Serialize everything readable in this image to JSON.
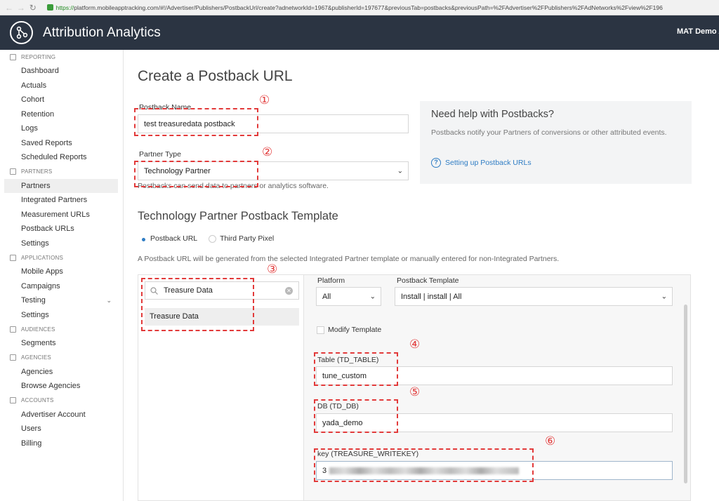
{
  "browser": {
    "url_scheme": "https://",
    "url_rest": "platform.mobileapptracking.com/#!/Advertiser/Publishers/PostbackUrl/create?adnetworkId=1967&publisherId=197677&previousTab=postbacks&previousPath=%2FAdvertiser%2FPublishers%2FAdNetworks%2Fview%2F196"
  },
  "header": {
    "app_title": "Attribution Analytics",
    "account_name": "MAT Demo A"
  },
  "sidebar": {
    "sections": [
      {
        "title": "REPORTING",
        "items": [
          "Dashboard",
          "Actuals",
          "Cohort",
          "Retention",
          "Logs",
          "Saved Reports",
          "Scheduled Reports"
        ]
      },
      {
        "title": "PARTNERS",
        "items": [
          "Partners",
          "Integrated Partners",
          "Measurement URLs",
          "Postback URLs",
          "Settings"
        ]
      },
      {
        "title": "APPLICATIONS",
        "items": [
          "Mobile Apps",
          "Campaigns",
          "Testing",
          "Settings"
        ]
      },
      {
        "title": "AUDIENCES",
        "items": [
          "Segments"
        ]
      },
      {
        "title": "AGENCIES",
        "items": [
          "Agencies",
          "Browse Agencies"
        ]
      },
      {
        "title": "ACCOUNTS",
        "items": [
          "Advertiser Account",
          "Users",
          "Billing"
        ]
      }
    ],
    "active_item": "Partners"
  },
  "main": {
    "page_title": "Create a Postback URL",
    "postback_name_label": "Postback Name",
    "postback_name_value": "test treasuredata postback",
    "partner_type_label": "Partner Type",
    "partner_type_value": "Technology Partner",
    "partner_type_help": "Postbacks can send data to partners or analytics software.",
    "help_panel": {
      "title": "Need help with Postbacks?",
      "body": "Postbacks notify your Partners of conversions or other attributed events.",
      "link_icon": "?",
      "link": "Setting up Postback URLs"
    },
    "template_section_title": "Technology Partner Postback Template",
    "radio_options": [
      "Postback URL",
      "Third Party Pixel"
    ],
    "radio_selected": "Postback URL",
    "info_text": "A Postback URL will be generated from the selected Integrated Partner template or manually entered for non-Integrated Partners.",
    "search_value": "Treasure Data",
    "search_result": "Treasure Data",
    "platform_label": "Platform",
    "platform_value": "All",
    "postback_template_label": "Postback Template",
    "postback_template_value": "Install | install | All",
    "modify_template_label": "Modify Template",
    "table_label": "Table (TD_TABLE)",
    "table_value": "tune_custom",
    "db_label": "DB (TD_DB)",
    "db_value": "yada_demo",
    "key_label": "key (TREASURE_WRITEKEY)",
    "key_value_prefix": "3"
  },
  "annotations": [
    "①",
    "②",
    "③",
    "④",
    "⑤",
    "⑥"
  ],
  "colors": {
    "header_bg": "#2b3442",
    "accent": "#2f7dc4",
    "annotation": "#e23a3a"
  }
}
